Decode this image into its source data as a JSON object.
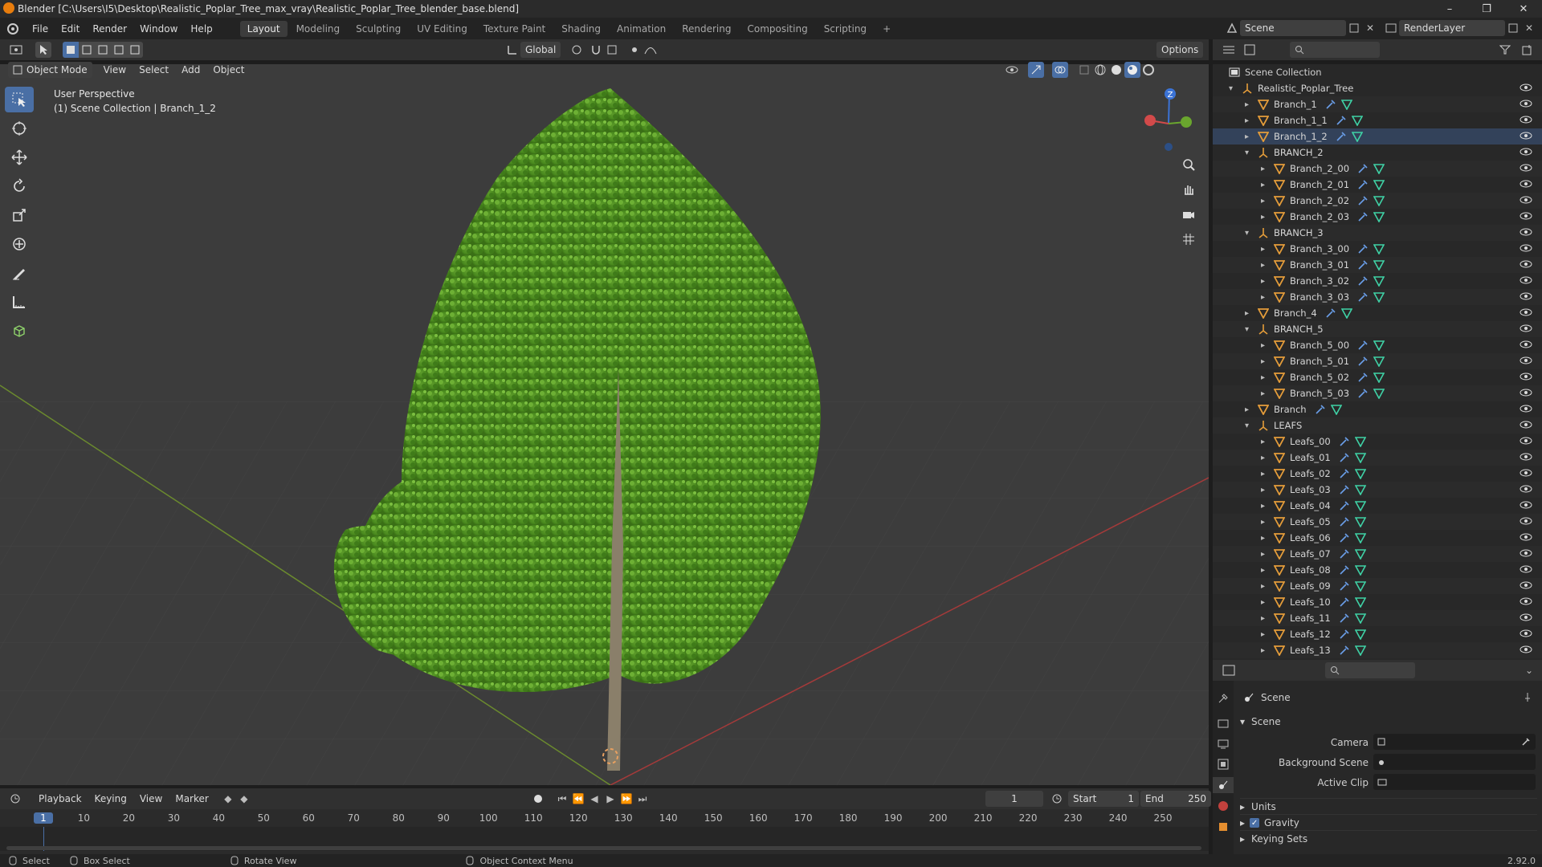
{
  "window": {
    "title": "Blender [C:\\Users\\I5\\Desktop\\Realistic_Poplar_Tree_max_vray\\Realistic_Poplar_Tree_blender_base.blend]",
    "minimize": "–",
    "maximize": "❐",
    "close": "✕"
  },
  "menu": [
    "File",
    "Edit",
    "Render",
    "Window",
    "Help"
  ],
  "workspaces": [
    "Layout",
    "Modeling",
    "Sculpting",
    "UV Editing",
    "Texture Paint",
    "Shading",
    "Animation",
    "Rendering",
    "Compositing",
    "Scripting"
  ],
  "workspace_add": "+",
  "scene_selector": {
    "value": "Scene"
  },
  "view_layer_selector": {
    "value": "RenderLayer"
  },
  "viewport_header": {
    "mode": "Object Mode",
    "menus": [
      "View",
      "Select",
      "Add",
      "Object"
    ],
    "orientation": "Global",
    "options": "Options"
  },
  "viewport": {
    "perspective": "User Perspective",
    "collection_info": "(1) Scene Collection | Branch_1_2",
    "gizmo": {
      "z": "Z",
      "x": "X",
      "y": "Y"
    }
  },
  "outliner": {
    "root": "Scene Collection",
    "rows": [
      {
        "name": "Realistic_Poplar_Tree",
        "level": 0,
        "type": "empty",
        "expanded": true
      },
      {
        "name": "Branch_1",
        "level": 1,
        "type": "mesh"
      },
      {
        "name": "Branch_1_1",
        "level": 1,
        "type": "mesh"
      },
      {
        "name": "Branch_1_2",
        "level": 1,
        "type": "mesh",
        "selected": true
      },
      {
        "name": "BRANCH_2",
        "level": 1,
        "type": "empty",
        "expanded": true
      },
      {
        "name": "Branch_2_00",
        "level": 2,
        "type": "mesh"
      },
      {
        "name": "Branch_2_01",
        "level": 2,
        "type": "mesh"
      },
      {
        "name": "Branch_2_02",
        "level": 2,
        "type": "mesh"
      },
      {
        "name": "Branch_2_03",
        "level": 2,
        "type": "mesh"
      },
      {
        "name": "BRANCH_3",
        "level": 1,
        "type": "empty",
        "expanded": true
      },
      {
        "name": "Branch_3_00",
        "level": 2,
        "type": "mesh"
      },
      {
        "name": "Branch_3_01",
        "level": 2,
        "type": "mesh"
      },
      {
        "name": "Branch_3_02",
        "level": 2,
        "type": "mesh"
      },
      {
        "name": "Branch_3_03",
        "level": 2,
        "type": "mesh"
      },
      {
        "name": "Branch_4",
        "level": 1,
        "type": "mesh"
      },
      {
        "name": "BRANCH_5",
        "level": 1,
        "type": "empty",
        "expanded": true
      },
      {
        "name": "Branch_5_00",
        "level": 2,
        "type": "mesh"
      },
      {
        "name": "Branch_5_01",
        "level": 2,
        "type": "mesh"
      },
      {
        "name": "Branch_5_02",
        "level": 2,
        "type": "mesh"
      },
      {
        "name": "Branch_5_03",
        "level": 2,
        "type": "mesh"
      },
      {
        "name": "Branch",
        "level": 1,
        "type": "mesh"
      },
      {
        "name": "LEAFS",
        "level": 1,
        "type": "empty",
        "expanded": true
      },
      {
        "name": "Leafs_00",
        "level": 2,
        "type": "mesh"
      },
      {
        "name": "Leafs_01",
        "level": 2,
        "type": "mesh"
      },
      {
        "name": "Leafs_02",
        "level": 2,
        "type": "mesh"
      },
      {
        "name": "Leafs_03",
        "level": 2,
        "type": "mesh"
      },
      {
        "name": "Leafs_04",
        "level": 2,
        "type": "mesh"
      },
      {
        "name": "Leafs_05",
        "level": 2,
        "type": "mesh"
      },
      {
        "name": "Leafs_06",
        "level": 2,
        "type": "mesh"
      },
      {
        "name": "Leafs_07",
        "level": 2,
        "type": "mesh"
      },
      {
        "name": "Leafs_08",
        "level": 2,
        "type": "mesh"
      },
      {
        "name": "Leafs_09",
        "level": 2,
        "type": "mesh"
      },
      {
        "name": "Leafs_10",
        "level": 2,
        "type": "mesh"
      },
      {
        "name": "Leafs_11",
        "level": 2,
        "type": "mesh"
      },
      {
        "name": "Leafs_12",
        "level": 2,
        "type": "mesh"
      },
      {
        "name": "Leafs_13",
        "level": 2,
        "type": "mesh"
      }
    ]
  },
  "properties": {
    "context_title": "Scene",
    "panel": "Scene",
    "fields": [
      {
        "label": "Camera",
        "value": ""
      },
      {
        "label": "Background Scene",
        "value": ""
      },
      {
        "label": "Active Clip",
        "value": ""
      }
    ],
    "subpanels": [
      {
        "label": "Units",
        "checkbox": false
      },
      {
        "label": "Gravity",
        "checkbox": true,
        "checked": true
      },
      {
        "label": "Keying Sets",
        "checkbox": false
      }
    ]
  },
  "timeline": {
    "menus": [
      "Playback",
      "Keying",
      "View",
      "Marker"
    ],
    "current_frame": "1",
    "start_label": "Start",
    "start": "1",
    "end_label": "End",
    "end": "250",
    "ticks": [
      "1",
      "10",
      "20",
      "30",
      "40",
      "50",
      "60",
      "70",
      "80",
      "90",
      "100",
      "110",
      "120",
      "130",
      "140",
      "150",
      "160",
      "170",
      "180",
      "190",
      "200",
      "210",
      "220",
      "230",
      "240",
      "250"
    ]
  },
  "status": {
    "items": [
      "Select",
      "Box Select",
      "Rotate View",
      "Object Context Menu"
    ],
    "version": "2.92.0"
  },
  "colors": {
    "accent": "#4a6fa5",
    "mesh_icon": "#e59d3a",
    "wrench_icon": "#6a9ee8",
    "tri_icon": "#3fd2a6",
    "foliage": "#4f8f22"
  }
}
